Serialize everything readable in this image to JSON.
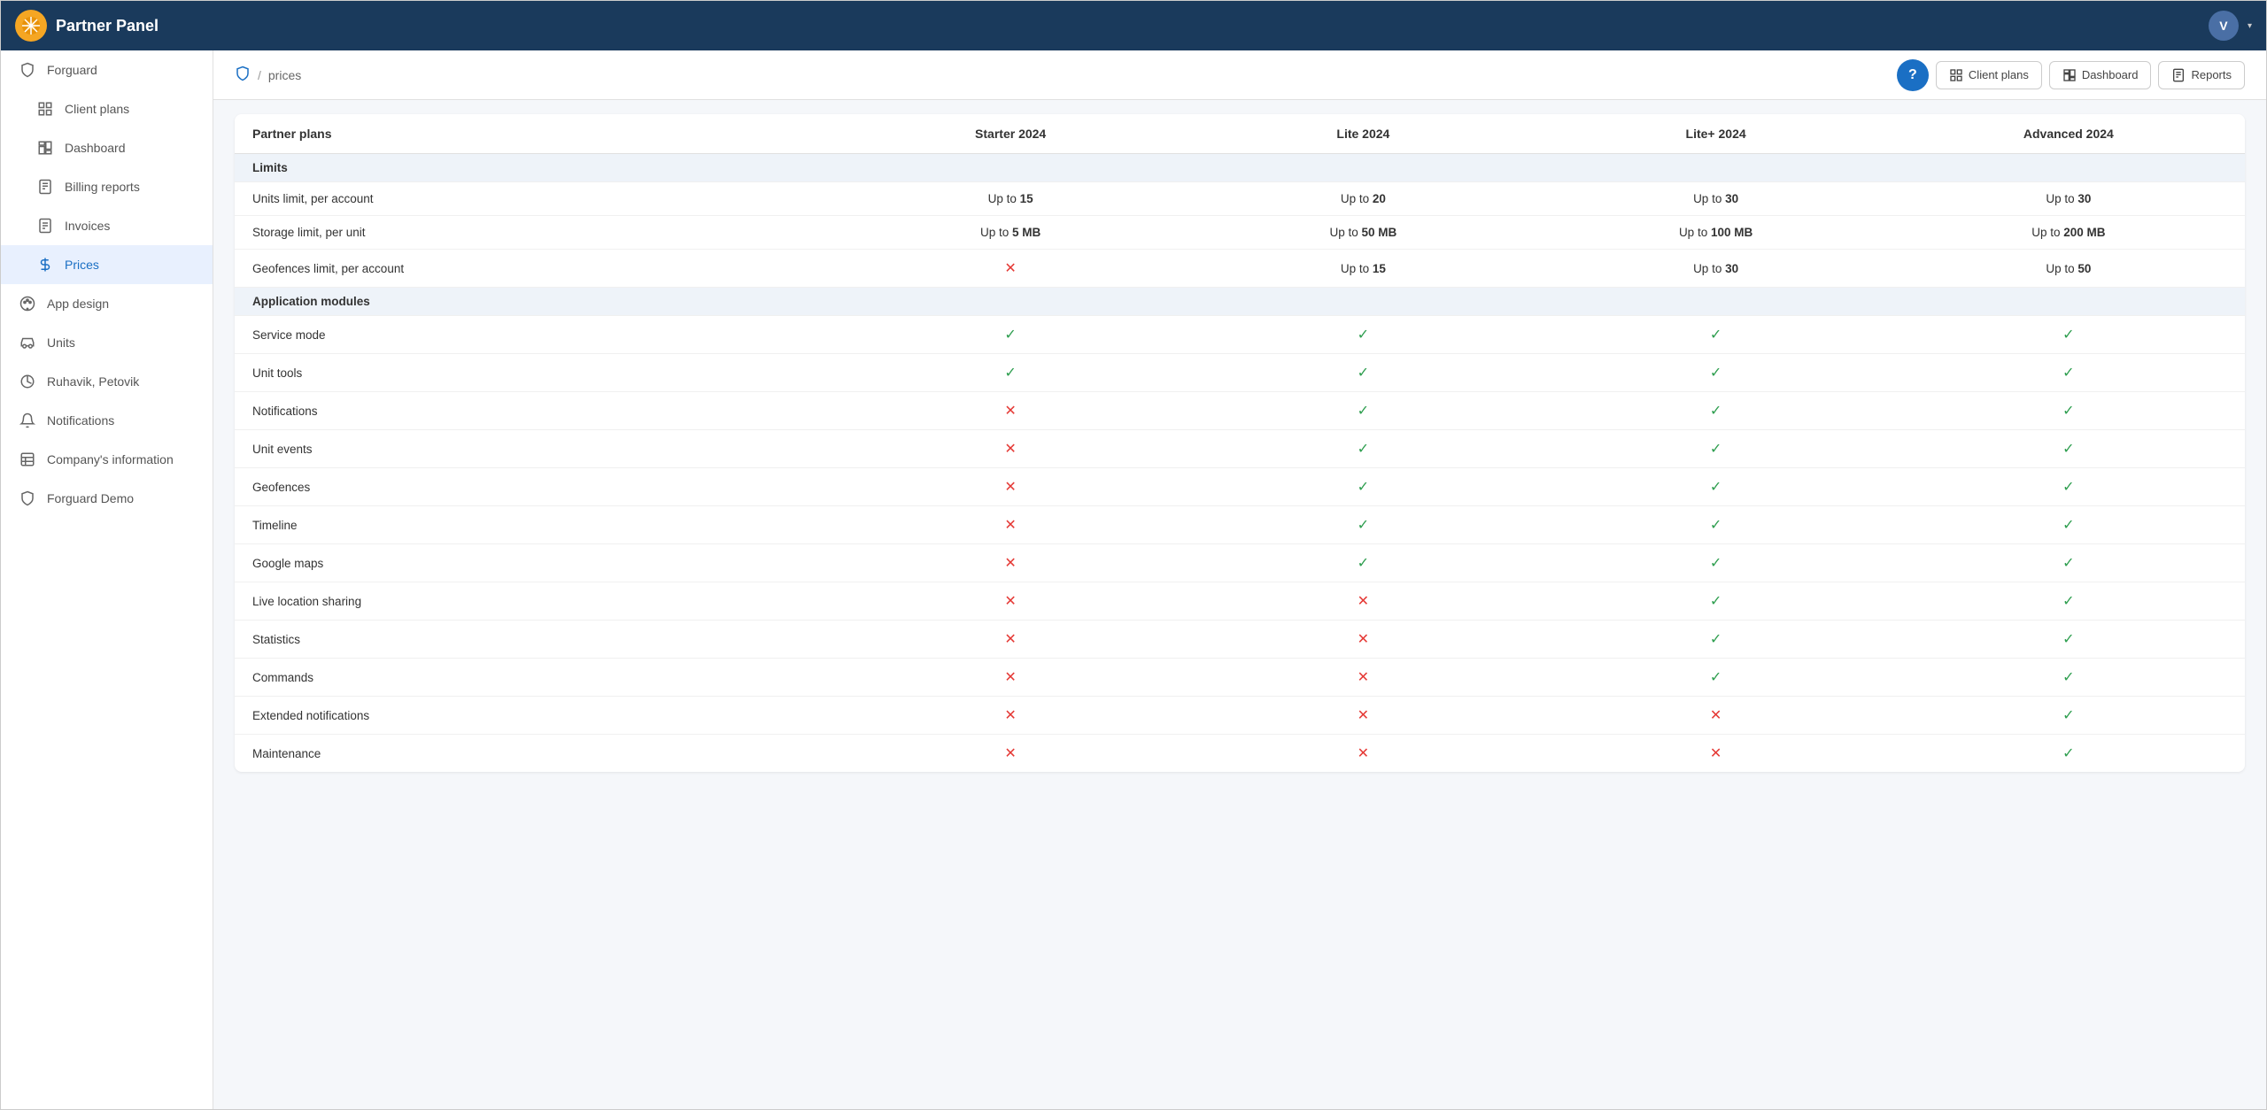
{
  "app": {
    "title": "Partner Panel",
    "user_initial": "V"
  },
  "sidebar": {
    "items": [
      {
        "id": "forguard",
        "label": "Forguard",
        "icon": "shield",
        "active": false,
        "indent": false
      },
      {
        "id": "client-plans",
        "label": "Client plans",
        "icon": "grid",
        "active": false,
        "indent": true
      },
      {
        "id": "dashboard",
        "label": "Dashboard",
        "icon": "dashboard",
        "active": false,
        "indent": true
      },
      {
        "id": "billing-reports",
        "label": "Billing reports",
        "icon": "report",
        "active": false,
        "indent": true
      },
      {
        "id": "invoices",
        "label": "Invoices",
        "icon": "invoice",
        "active": false,
        "indent": true
      },
      {
        "id": "prices",
        "label": "Prices",
        "icon": "dollar",
        "active": true,
        "indent": true
      },
      {
        "id": "app-design",
        "label": "App design",
        "icon": "palette",
        "active": false,
        "indent": false
      },
      {
        "id": "units",
        "label": "Units",
        "icon": "car",
        "active": false,
        "indent": false
      },
      {
        "id": "ruhavik",
        "label": "Ruhavik, Petovik",
        "icon": "widget",
        "active": false,
        "indent": false
      },
      {
        "id": "notifications",
        "label": "Notifications",
        "icon": "bell",
        "active": false,
        "indent": false
      },
      {
        "id": "company-info",
        "label": "Company's information",
        "icon": "table",
        "active": false,
        "indent": false
      },
      {
        "id": "forguard-demo",
        "label": "Forguard Demo",
        "icon": "shield-outline",
        "active": false,
        "indent": false
      }
    ]
  },
  "breadcrumb": {
    "icon": "shield",
    "separator": "/",
    "current": "prices"
  },
  "header_buttons": {
    "client_plans": "Client plans",
    "dashboard": "Dashboard",
    "reports": "Reports"
  },
  "table": {
    "columns": [
      "Partner plans",
      "Starter 2024",
      "Lite 2024",
      "Lite+ 2024",
      "Advanced 2024"
    ],
    "sections": [
      {
        "name": "Limits",
        "rows": [
          {
            "feature": "Units limit, per account",
            "starter": {
              "type": "text",
              "value": "Up to ",
              "bold": "15"
            },
            "lite": {
              "type": "text",
              "value": "Up to ",
              "bold": "20"
            },
            "lite_plus": {
              "type": "text",
              "value": "Up to ",
              "bold": "30"
            },
            "advanced": {
              "type": "text",
              "value": "Up to ",
              "bold": "30"
            }
          },
          {
            "feature": "Storage limit, per unit",
            "starter": {
              "type": "text",
              "value": "Up to ",
              "bold": "5 MB"
            },
            "lite": {
              "type": "text",
              "value": "Up to ",
              "bold": "50 MB"
            },
            "lite_plus": {
              "type": "text",
              "value": "Up to ",
              "bold": "100 MB"
            },
            "advanced": {
              "type": "text",
              "value": "Up to ",
              "bold": "200 MB"
            }
          },
          {
            "feature": "Geofences limit, per account",
            "starter": {
              "type": "cross"
            },
            "lite": {
              "type": "text",
              "value": "Up to ",
              "bold": "15"
            },
            "lite_plus": {
              "type": "text",
              "value": "Up to ",
              "bold": "30"
            },
            "advanced": {
              "type": "text",
              "value": "Up to ",
              "bold": "50"
            }
          }
        ]
      },
      {
        "name": "Application modules",
        "rows": [
          {
            "feature": "Service mode",
            "starter": {
              "type": "check"
            },
            "lite": {
              "type": "check"
            },
            "lite_plus": {
              "type": "check"
            },
            "advanced": {
              "type": "check"
            }
          },
          {
            "feature": "Unit tools",
            "starter": {
              "type": "check"
            },
            "lite": {
              "type": "check"
            },
            "lite_plus": {
              "type": "check"
            },
            "advanced": {
              "type": "check"
            }
          },
          {
            "feature": "Notifications",
            "starter": {
              "type": "cross"
            },
            "lite": {
              "type": "check"
            },
            "lite_plus": {
              "type": "check"
            },
            "advanced": {
              "type": "check"
            }
          },
          {
            "feature": "Unit events",
            "starter": {
              "type": "cross"
            },
            "lite": {
              "type": "check"
            },
            "lite_plus": {
              "type": "check"
            },
            "advanced": {
              "type": "check"
            }
          },
          {
            "feature": "Geofences",
            "starter": {
              "type": "cross"
            },
            "lite": {
              "type": "check"
            },
            "lite_plus": {
              "type": "check"
            },
            "advanced": {
              "type": "check"
            }
          },
          {
            "feature": "Timeline",
            "starter": {
              "type": "cross"
            },
            "lite": {
              "type": "check"
            },
            "lite_plus": {
              "type": "check"
            },
            "advanced": {
              "type": "check"
            }
          },
          {
            "feature": "Google maps",
            "starter": {
              "type": "cross"
            },
            "lite": {
              "type": "check"
            },
            "lite_plus": {
              "type": "check"
            },
            "advanced": {
              "type": "check"
            }
          },
          {
            "feature": "Live location sharing",
            "starter": {
              "type": "cross"
            },
            "lite": {
              "type": "cross"
            },
            "lite_plus": {
              "type": "check"
            },
            "advanced": {
              "type": "check"
            }
          },
          {
            "feature": "Statistics",
            "starter": {
              "type": "cross"
            },
            "lite": {
              "type": "cross"
            },
            "lite_plus": {
              "type": "check"
            },
            "advanced": {
              "type": "check"
            }
          },
          {
            "feature": "Commands",
            "starter": {
              "type": "cross"
            },
            "lite": {
              "type": "cross"
            },
            "lite_plus": {
              "type": "check"
            },
            "advanced": {
              "type": "check"
            }
          },
          {
            "feature": "Extended notifications",
            "starter": {
              "type": "cross"
            },
            "lite": {
              "type": "cross"
            },
            "lite_plus": {
              "type": "cross"
            },
            "advanced": {
              "type": "check"
            }
          },
          {
            "feature": "Maintenance",
            "starter": {
              "type": "cross"
            },
            "lite": {
              "type": "cross"
            },
            "lite_plus": {
              "type": "cross"
            },
            "advanced": {
              "type": "check"
            }
          }
        ]
      }
    ]
  }
}
